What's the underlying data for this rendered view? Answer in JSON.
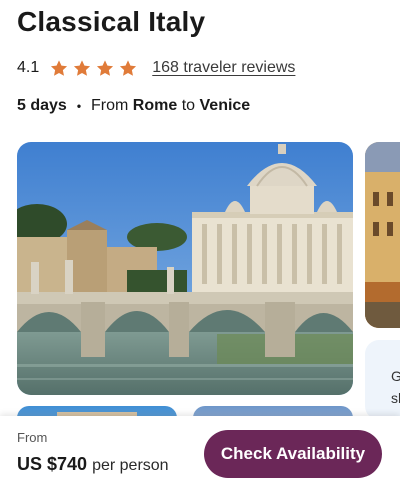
{
  "tour": {
    "title": "Classical Italy",
    "rating": "4.1",
    "rating_stars": 4,
    "reviews_text": "168 traveler reviews",
    "duration": "5 days",
    "route": {
      "from_prefix": "From",
      "origin": "Rome",
      "to_word": "to",
      "destination": "Venice"
    }
  },
  "peek_card": {
    "lines": [
      "G",
      "sh"
    ]
  },
  "booking": {
    "from_label": "From",
    "price": "US $740",
    "per_label": "per person",
    "cta_label": "Check Availability"
  },
  "colors": {
    "star": "#e07b39",
    "cta": "#6b2758"
  },
  "icons": {
    "star": "star-icon"
  }
}
